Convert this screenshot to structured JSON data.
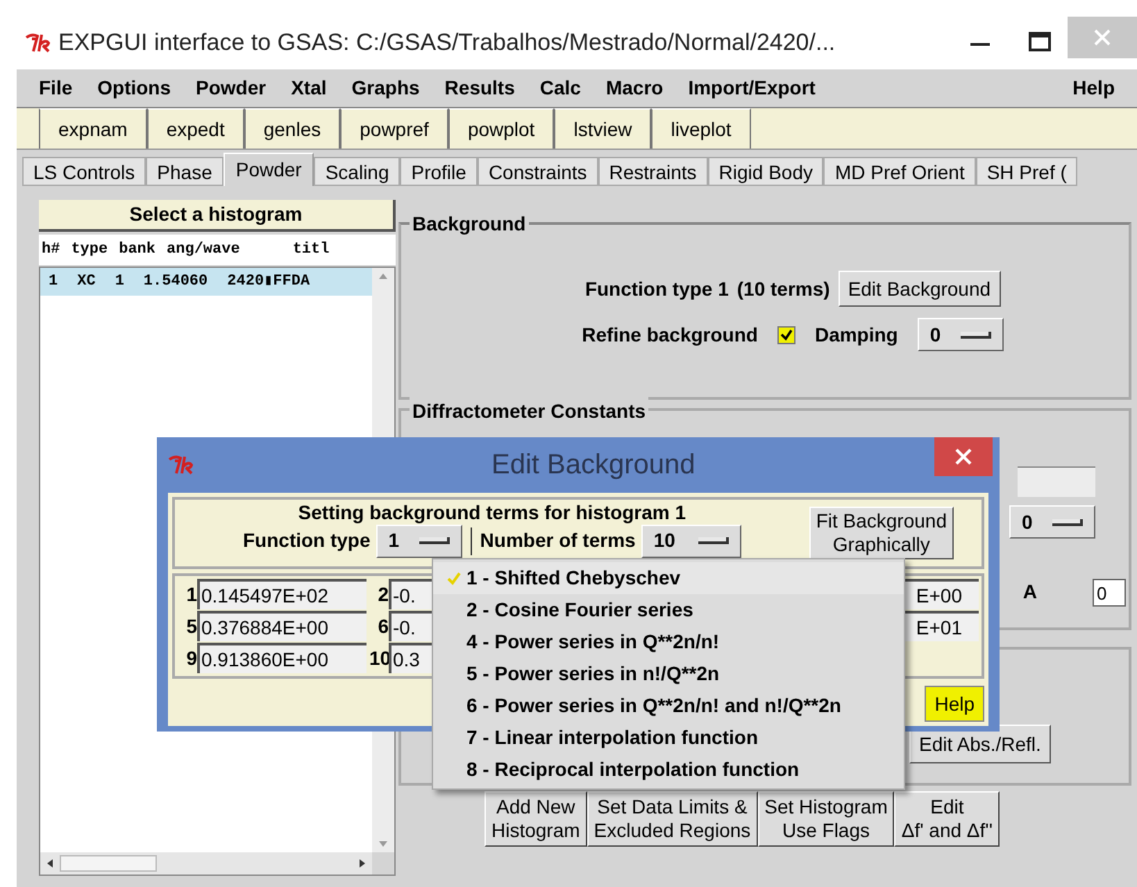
{
  "window": {
    "title": "EXPGUI interface to GSAS: C:/GSAS/Trabalhos/Mestrado/Normal/2420/..."
  },
  "menu_bar": [
    "File",
    "Options",
    "Powder",
    "Xtal",
    "Graphs",
    "Results",
    "Calc",
    "Macro",
    "Import/Export",
    "Help"
  ],
  "toolbar": [
    "expnam",
    "expedt",
    "genles",
    "powpref",
    "powplot",
    "lstview",
    "liveplot"
  ],
  "tabs": [
    {
      "label": "LS Controls",
      "selected": false
    },
    {
      "label": "Phase",
      "selected": false
    },
    {
      "label": "Powder",
      "selected": true
    },
    {
      "label": "Scaling",
      "selected": false
    },
    {
      "label": "Profile",
      "selected": false
    },
    {
      "label": "Constraints",
      "selected": false
    },
    {
      "label": "Restraints",
      "selected": false
    },
    {
      "label": "Rigid Body",
      "selected": false
    },
    {
      "label": "MD Pref Orient",
      "selected": false
    },
    {
      "label": "SH Pref (",
      "selected": false
    }
  ],
  "histogram_panel": {
    "title": "Select a histogram",
    "columns": [
      "h#",
      "type",
      "bank",
      "ang/wave",
      "titl"
    ],
    "rows": [
      {
        "cells": [
          "1",
          "XC",
          "1",
          "1.54060",
          "2420▮FFDA"
        ],
        "selected": true
      }
    ]
  },
  "background": {
    "title": "Background",
    "function_label": "Function type 1",
    "terms": "(10 terms)",
    "edit_button": "Edit Background",
    "refine_label": "Refine background",
    "refine_checked": true,
    "damping_label": "Damping",
    "damping_value": "0"
  },
  "diffractometer": {
    "title": "Diffractometer Constants",
    "dropdown_value": "0",
    "label": "A",
    "field_value": "0"
  },
  "absorption": {
    "button": "Edit Abs./Refl."
  },
  "bottom_buttons": [
    [
      "Add New",
      "Histogram"
    ],
    [
      "Set Data Limits &",
      "Excluded Regions"
    ],
    [
      "Set Histogram",
      "Use Flags"
    ],
    [
      "Edit",
      "Δf' and Δf''"
    ]
  ],
  "dialog": {
    "title": "Edit Background",
    "heading": "Setting background terms for histogram 1",
    "function_type_label": "Function type",
    "function_type_value": "1",
    "terms_label": "Number of terms",
    "terms_value": "10",
    "fit_button": [
      "Fit Background",
      "Graphically"
    ],
    "term_rows": [
      [
        {
          "label": "1",
          "value": "0.145497E+02"
        },
        {
          "label": "2",
          "value": "-0."
        },
        {
          "value": "E+00"
        }
      ],
      [
        {
          "label": "5",
          "value": "0.376884E+00"
        },
        {
          "label": "6",
          "value": "-0."
        },
        {
          "value": "E+01"
        }
      ],
      [
        {
          "label": "9",
          "value": "0.913860E+00"
        },
        {
          "label": "10",
          "value": "0.3"
        }
      ]
    ],
    "help": "Help"
  },
  "function_menu": [
    {
      "label": "1 - Shifted Chebyschev",
      "selected": true
    },
    {
      "label": "2 - Cosine Fourier series",
      "selected": false
    },
    {
      "label": "4 - Power series in Q**2n/n!",
      "selected": false
    },
    {
      "label": "5 - Power series in n!/Q**2n",
      "selected": false
    },
    {
      "label": "6 - Power series in Q**2n/n! and n!/Q**2n",
      "selected": false
    },
    {
      "label": "7 - Linear interpolation function",
      "selected": false
    },
    {
      "label": "8 - Reciprocal interpolation function",
      "selected": false
    }
  ]
}
